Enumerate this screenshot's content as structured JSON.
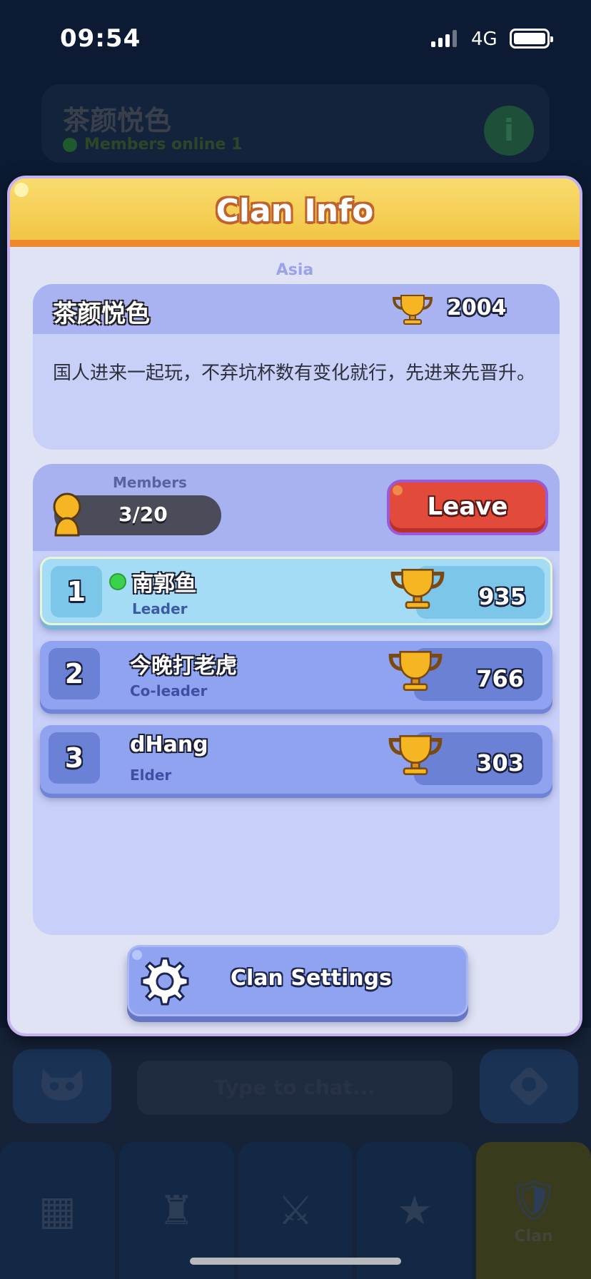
{
  "status_bar": {
    "time": "09:54",
    "network": "4G"
  },
  "background": {
    "clan_name": "茶颜悦色",
    "members_online": "Members online 1",
    "chat_placeholder": "Type to chat...",
    "nav_active_label": "Clan"
  },
  "modal": {
    "title": "Clan Info",
    "region": "Asia",
    "clan_name": "茶颜悦色",
    "trophies": "2004",
    "description": "国人进来一起玩，不弃坑杯数有变化就行，先进来先晋升。",
    "members_label": "Members",
    "members_count": "3/20",
    "leave_label": "Leave",
    "settings_label": "Clan Settings",
    "members": [
      {
        "rank": "1",
        "name": "南郭鱼",
        "role": "Leader",
        "trophies": "935",
        "online": true,
        "self": true
      },
      {
        "rank": "2",
        "name": "今晚打老虎",
        "role": "Co-leader",
        "trophies": "766",
        "online": false,
        "self": false
      },
      {
        "rank": "3",
        "name": "dHang",
        "role": "Elder",
        "trophies": "303",
        "online": false,
        "self": false
      }
    ]
  },
  "colors": {
    "header_yellow": "#f2c545",
    "header_orange": "#f0872c",
    "leave_red": "#e24a3b",
    "online_green": "#3bd14a",
    "row_blue": "#8fa3f1",
    "self_row": "#a5dcf5"
  },
  "icons": {
    "trophy": "trophy-icon",
    "member": "member-icon",
    "gear": "gear-icon",
    "info": "info-icon",
    "skull": "skull-icon",
    "clan": "clan-icon"
  }
}
